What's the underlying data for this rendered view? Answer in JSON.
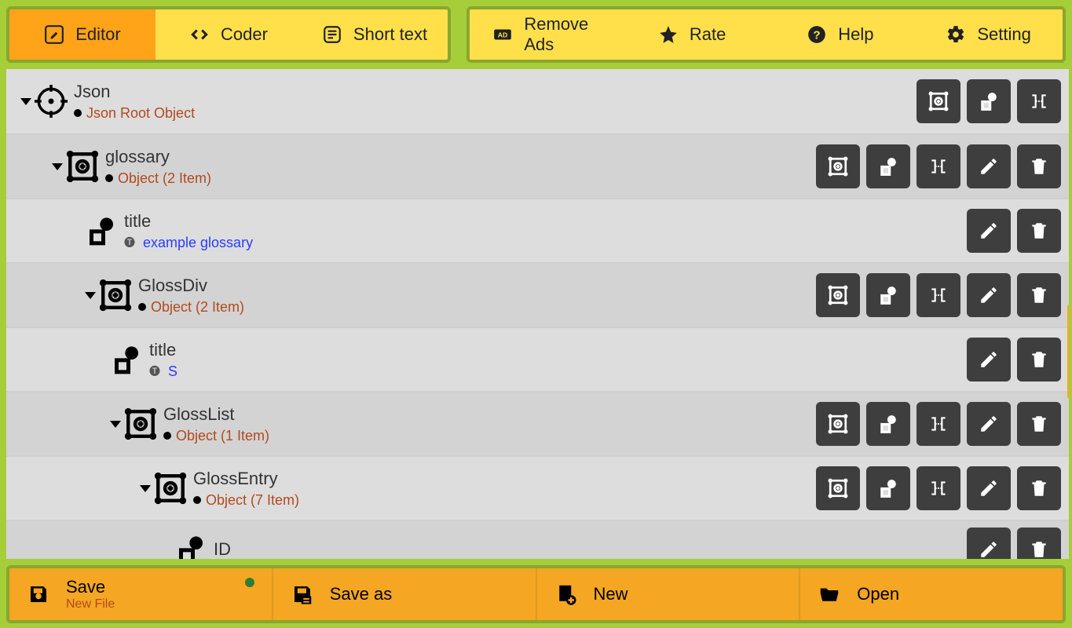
{
  "tabs": {
    "editor": "Editor",
    "coder": "Coder",
    "short_text": "Short text",
    "remove_ads": "Remove Ads",
    "rate": "Rate",
    "help": "Help",
    "setting": "Setting"
  },
  "tree": {
    "root_key": "Json",
    "root_meta": "Json Root Object",
    "glossary_key": "glossary",
    "glossary_meta": "Object (2 Item)",
    "title1_key": "title",
    "title1_val": "example glossary",
    "glossdiv_key": "GlossDiv",
    "glossdiv_meta": "Object (2 Item)",
    "title2_key": "title",
    "title2_val": "S",
    "glosslist_key": "GlossList",
    "glosslist_meta": "Object (1 Item)",
    "glossentry_key": "GlossEntry",
    "glossentry_meta": "Object (7 Item)",
    "id_key": "ID"
  },
  "bottom": {
    "save": "Save",
    "save_sub": "New File",
    "save_as": "Save as",
    "new": "New",
    "open": "Open"
  }
}
